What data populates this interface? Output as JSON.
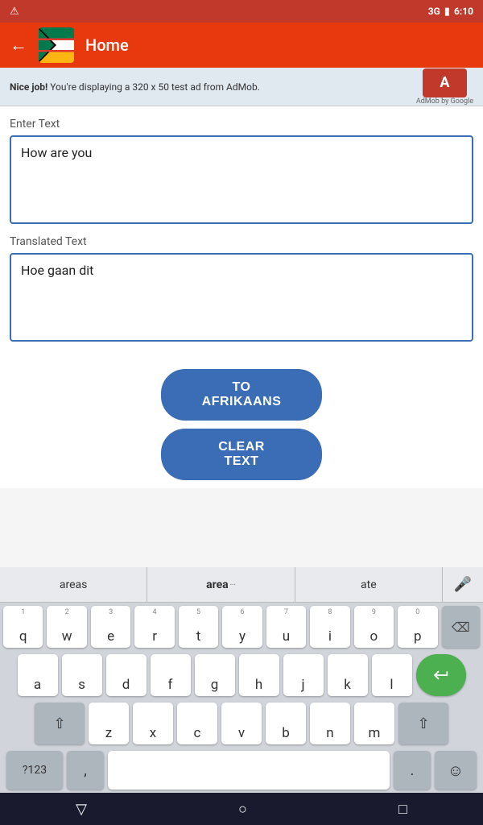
{
  "statusBar": {
    "signal": "3G",
    "batteryIcon": "🔋",
    "time": "6:10",
    "alertIcon": "⚠"
  },
  "topBar": {
    "backLabel": "←",
    "title": "Home"
  },
  "adBanner": {
    "text_bold": "Nice job!",
    "text_normal": " You're displaying a 320 x 50 test ad from AdMob.",
    "logoText": "A",
    "subText": "AdMob by Google"
  },
  "main": {
    "enterTextLabel": "Enter Text",
    "inputText": "How are you",
    "translatedTextLabel": "Translated Text",
    "translatedText": "Hoe gaan dit",
    "btnToAfrikaans": "TO AFRIKAANS",
    "btnClearText": "CLEAR TEXT"
  },
  "keyboard": {
    "suggestions": [
      "areas",
      "area",
      "ate"
    ],
    "rows": [
      {
        "numbers": [
          "1",
          "2",
          "3",
          "4",
          "5",
          "6",
          "7",
          "8",
          "9",
          "0"
        ],
        "letters": [
          "q",
          "w",
          "e",
          "r",
          "t",
          "y",
          "u",
          "i",
          "o",
          "p"
        ]
      },
      {
        "letters": [
          "a",
          "s",
          "d",
          "f",
          "g",
          "h",
          "j",
          "k",
          "l"
        ]
      },
      {
        "letters": [
          "z",
          "x",
          "c",
          "v",
          "b",
          "n",
          "m"
        ]
      }
    ],
    "bottomRow": {
      "numbers": "?123",
      "comma": ",",
      "spacePlaceholder": "",
      "period": ".",
      "emoji": "☺"
    }
  },
  "navBar": {
    "back": "▽",
    "home": "○",
    "recent": "□"
  }
}
